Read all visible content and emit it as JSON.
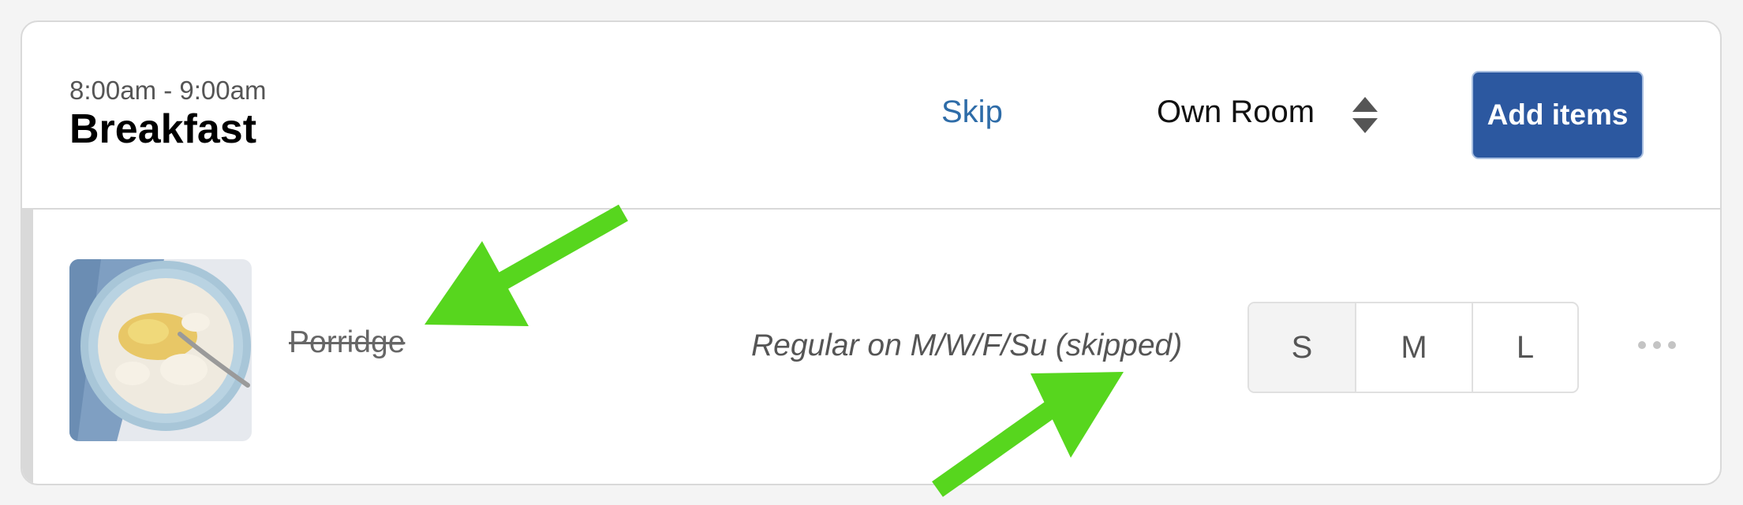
{
  "meal": {
    "time": "8:00am - 9:00am",
    "title": "Breakfast",
    "skip_label": "Skip",
    "room_label": "Own Room",
    "add_label": "Add items"
  },
  "item": {
    "name": "Porridge",
    "schedule": "Regular on M/W/F/Su (skipped)",
    "sizes": [
      "S",
      "M",
      "L"
    ],
    "selected_size": "S",
    "image": "porridge bowl"
  },
  "annotations": {
    "arrow_color": "#57d61e"
  },
  "colors": {
    "link": "#2e6ca8",
    "button": "#2c58a0"
  }
}
